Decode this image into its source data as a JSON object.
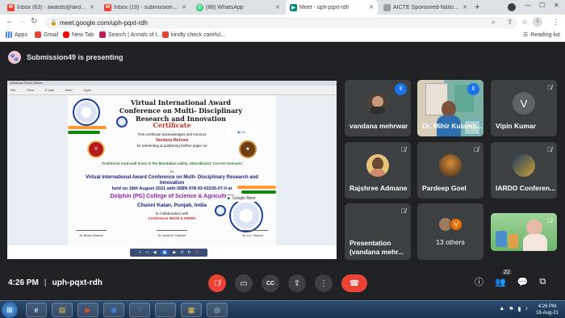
{
  "browser": {
    "tabs": [
      {
        "title": "Inbox (63) - awards@iardo.co...",
        "icon": "gmail-icon",
        "color": "#ea4335"
      },
      {
        "title": "Inbox (18) - submission@iardo...",
        "icon": "gmail-icon",
        "color": "#ea4335"
      },
      {
        "title": "(88) WhatsApp",
        "icon": "whatsapp-icon",
        "color": "#25d366"
      },
      {
        "title": "Meet - uph-pqxt-rdh",
        "icon": "meet-icon",
        "color": "#00897b"
      },
      {
        "title": "AICTE Sponsored-National Co...",
        "icon": "page-icon",
        "color": "#5f6368"
      }
    ],
    "url": "meet.google.com/uph-pqxt-rdh",
    "bookmarks": [
      {
        "label": "Apps",
        "icon": "apps-grid-icon",
        "color": "#4285f4"
      },
      {
        "label": "Gmail",
        "icon": "gmail-icon",
        "color": "#ea4335"
      },
      {
        "label": "New Tab",
        "icon": "youtube-icon",
        "color": "#ff0000"
      },
      {
        "label": "Search | Annals of t...",
        "icon": "bookmark-icon",
        "color": "#c2185b"
      },
      {
        "label": "kindly check careful...",
        "icon": "gmail-icon",
        "color": "#ea4335"
      }
    ],
    "reading_list": "Reading list"
  },
  "meet": {
    "presenting_text": "Submission49 is presenting",
    "time": "4:26 PM",
    "meeting_code": "uph-pqxt-rdh",
    "participant_count": "22",
    "participants": [
      {
        "name": "vandana mehrwar",
        "state": "speaking"
      },
      {
        "name": "Dr. Mihir Kulamb...",
        "state": "speaking"
      },
      {
        "name": "Vipin Kumar",
        "initial": "V",
        "state": "muted"
      },
      {
        "name": "Rajshree Admane",
        "state": "muted"
      },
      {
        "name": "Pardeep Goel",
        "state": "muted"
      },
      {
        "name": "IARDO Conferen...",
        "state": "muted"
      },
      {
        "name": "Presentation (vandana mehr...",
        "state": "muted"
      },
      {
        "name": "13 others",
        "initial": "V"
      },
      {
        "name": "",
        "state": "muted"
      }
    ]
  },
  "certificate": {
    "viewer_title": "Windows Photo Viewer",
    "viewer_menu": [
      "File",
      "Print",
      "E-mail",
      "Burn",
      "Open"
    ],
    "title": "Virtual International Award Conference on Multi- Disciplinary Research and Innovation",
    "heading": "Certificate",
    "ack": "This certificate acknowledges and honours",
    "name": "Vandana Mehrwa",
    "for_text": "for presenting & publishing his/her paper on",
    "paper": "Traditional mud-wall hives in the Mandakini valley, Uttarakhand: Current Scenario",
    "in_text": "in",
    "conference": "Virtual International Award Conference on Multi- Disciplinary Research and Innovation",
    "held": "held on 18th August 2021 with ISBN 978-93-91535-07-0 at",
    "college": "Dolphin (PG) College of Science & Agriculture",
    "place": "Chunni Kalan, Punjab, India",
    "collab": "in Collaboration with",
    "org": "Conference World & IARDO",
    "gmeet": "Google Meet",
    "signatories": [
      "Dr. Bhanu Sharma",
      "Dr. Vishal M. Kulambe",
      "Mr. A.K. Sharma"
    ]
  },
  "taskbar": {
    "clock_time": "4:26 PM",
    "clock_date": "18-Aug-21"
  }
}
